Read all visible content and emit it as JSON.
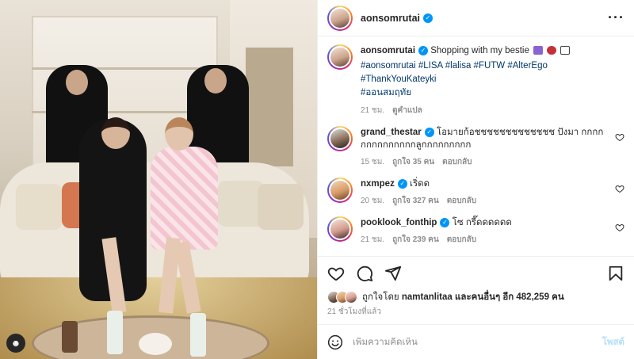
{
  "post": {
    "username": "aonsomrutai",
    "caption": "Shopping with my bestie",
    "hashtags_line1": "#aonsomrutai #LISA #lalisa #FUTW #AlterEgo #ThankYouKateyki",
    "hashtags_line2": "#ออนสมฤทัย",
    "caption_time": "21 ชม.",
    "see_translation": "ดูคำแปล",
    "likes_prefix": "ถูกใจโดย",
    "likes_user": "namtanlitaa",
    "likes_suffix": "และคนอื่นๆ อีก 482,259 คน",
    "time_ago": "21 ชั่วโมงที่แล้ว"
  },
  "comments": [
    {
      "username": "grand_thestar",
      "text": "โอมายก้อชชชชชชชชชชชชช ปังมา กกกกกกกกกกกกกกลูกกกกกกกกก",
      "time": "15 ชม.",
      "likes": "ถูกใจ 35 คน",
      "reply": "ตอบกลับ"
    },
    {
      "username": "nxmpez",
      "text": "เริ่ดด",
      "time": "20 ชม.",
      "likes": "ถูกใจ 327 คน",
      "reply": "ตอบกลับ"
    },
    {
      "username": "pooklook_fonthip",
      "text": "โซ กรี๊ดดดดดด",
      "time": "21 ชม.",
      "likes": "ถูกใจ 239 คน",
      "reply": "ตอบกลับ"
    }
  ],
  "composer": {
    "placeholder": "เพิ่มความคิดเห็น",
    "post_label": "โพสต์"
  },
  "icons": [
    "more-icon",
    "verified-icon",
    "heart-icon",
    "comment-icon",
    "share-icon",
    "bookmark-icon",
    "emoji-icon",
    "user-tag-icon"
  ],
  "colors": {
    "link": "#00376b",
    "verified": "#0095f6",
    "muted": "#8e8e8e",
    "post_button_disabled": "#b2dffc"
  }
}
